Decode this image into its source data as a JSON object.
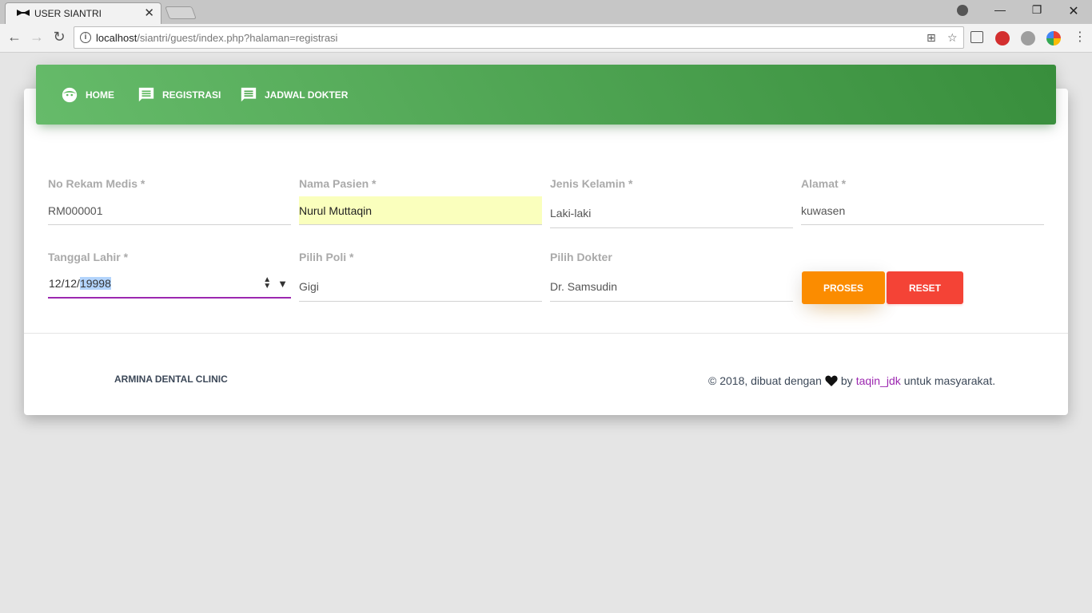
{
  "browser": {
    "tab_title": "USER SIANTRI",
    "tab_close": "✕",
    "url_host": "localhost",
    "url_path": "/siantri/guest/index.php?halaman=registrasi",
    "win_minimize": "—",
    "win_restore": "❐",
    "win_close": "✕"
  },
  "nav": {
    "items": [
      {
        "label": "HOME",
        "icon": "face-icon"
      },
      {
        "label": "REGISTRASI",
        "icon": "chat-icon"
      },
      {
        "label": "JADWAL DOKTER",
        "icon": "chat-icon"
      }
    ]
  },
  "form": {
    "no_rekam_medis": {
      "label": "No Rekam Medis *",
      "value": "RM000001"
    },
    "nama_pasien": {
      "label": "Nama Pasien *",
      "value": "Nurul Muttaqin"
    },
    "jenis_kelamin": {
      "label": "Jenis Kelamin *",
      "value": "Laki-laki"
    },
    "alamat": {
      "label": "Alamat *",
      "value": "kuwasen"
    },
    "tanggal_lahir": {
      "label": "Tanggal Lahir *",
      "value_prefix": "12/12/",
      "value_selected": "19998"
    },
    "pilih_poli": {
      "label": "Pilih Poli *",
      "value": "Gigi"
    },
    "pilih_dokter": {
      "label": "Pilih Dokter",
      "value": "Dr. Samsudin"
    },
    "proses_label": "PROSES",
    "reset_label": "RESET"
  },
  "footer": {
    "brand": "ARMINA DENTAL CLINIC",
    "copy_prefix": "© 2018, dibuat dengan",
    "copy_by": "by",
    "author": "taqin_jdk",
    "copy_suffix": "untuk masyarakat."
  },
  "colors": {
    "navbar_start": "#66bb6a",
    "navbar_end": "#388e3c",
    "proses": "#fb8c00",
    "reset": "#f44336",
    "focus_underline": "#9c27b0",
    "author_link": "#9c27b0"
  }
}
